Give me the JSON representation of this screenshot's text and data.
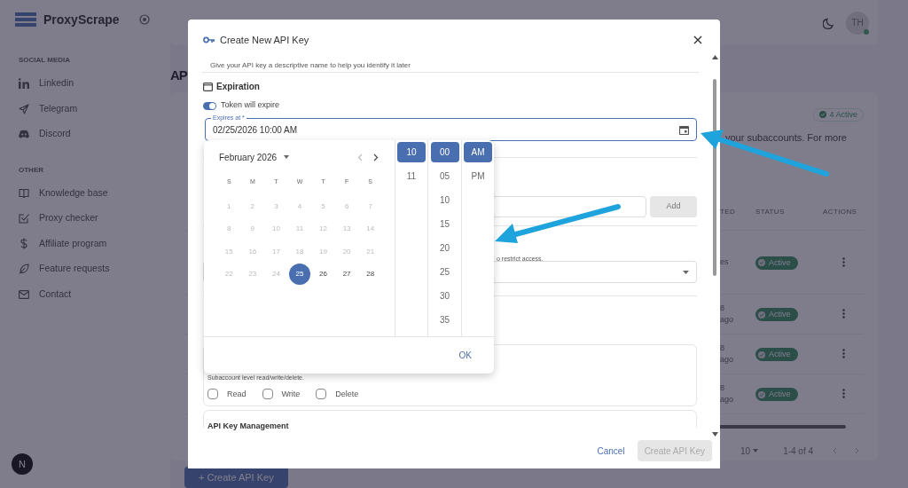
{
  "sidebar": {
    "brand": "ProxyScrape",
    "sections": [
      {
        "heading": "SOCIAL MEDIA",
        "items": [
          "Linkedin",
          "Telegram",
          "Discord"
        ]
      },
      {
        "heading": "OTHER",
        "items": [
          "Knowledge base",
          "Proxy checker",
          "Affiliate program",
          "Feature requests",
          "Contact"
        ]
      }
    ]
  },
  "header": {
    "avatar": "TH"
  },
  "page": {
    "title": "AP",
    "active_badge": "4 Active",
    "description": "your subaccounts. For more",
    "table": {
      "columns": [
        "TED",
        "STATUS",
        "ACTIONS"
      ],
      "rows": [
        {
          "created": [
            "es"
          ],
          "status": "Active"
        },
        {
          "created": [
            "8",
            "ago"
          ],
          "status": "Active"
        },
        {
          "created": [
            "8",
            "ago"
          ],
          "status": "Active"
        },
        {
          "created": [
            "8",
            "ago"
          ],
          "status": "Active"
        }
      ]
    },
    "pagination": {
      "rows_per_page": "10",
      "range": "1-4 of 4"
    },
    "create_button": "+ Create API Key"
  },
  "dev_badge": "N",
  "dialog": {
    "title": "Create New API Key",
    "subtitle": "Give your API key a descriptive name to help you identify it later",
    "expiration": {
      "heading": "Expiration",
      "toggle": {
        "label": "Token will expire",
        "on": true
      },
      "field": {
        "label": "Expires at *",
        "value": "02/25/2026 10:00 AM"
      }
    },
    "add_button": {
      "label": "Add",
      "disabled": true
    },
    "restrict_hint": "o restrict access.",
    "permissions": {
      "description": "Subaccount level read/write/delete.",
      "options": [
        {
          "label": "Read",
          "checked": false
        },
        {
          "label": "Write",
          "checked": false
        },
        {
          "label": "Delete",
          "checked": false
        }
      ]
    },
    "management_heading": "API Key Management",
    "cancel": "Cancel",
    "create": {
      "label": "Create API Key",
      "disabled": true
    }
  },
  "picker": {
    "month": "February 2026",
    "weekdays": [
      "S",
      "M",
      "T",
      "W",
      "T",
      "F",
      "S"
    ],
    "days": [
      {
        "label": "1",
        "disabled": true,
        "selected": false
      },
      {
        "label": "2",
        "disabled": true,
        "selected": false
      },
      {
        "label": "3",
        "disabled": true,
        "selected": false
      },
      {
        "label": "4",
        "disabled": true,
        "selected": false
      },
      {
        "label": "5",
        "disabled": true,
        "selected": false
      },
      {
        "label": "6",
        "disabled": true,
        "selected": false
      },
      {
        "label": "7",
        "disabled": true,
        "selected": false
      },
      {
        "label": "8",
        "disabled": true,
        "selected": false
      },
      {
        "label": "9",
        "disabled": true,
        "selected": false
      },
      {
        "label": "10",
        "disabled": true,
        "selected": false
      },
      {
        "label": "11",
        "disabled": true,
        "selected": false
      },
      {
        "label": "12",
        "disabled": true,
        "selected": false
      },
      {
        "label": "13",
        "disabled": true,
        "selected": false
      },
      {
        "label": "14",
        "disabled": true,
        "selected": false
      },
      {
        "label": "15",
        "disabled": true,
        "selected": false
      },
      {
        "label": "16",
        "disabled": true,
        "selected": false
      },
      {
        "label": "17",
        "disabled": true,
        "selected": false
      },
      {
        "label": "18",
        "disabled": true,
        "selected": false
      },
      {
        "label": "19",
        "disabled": true,
        "selected": false
      },
      {
        "label": "20",
        "disabled": true,
        "selected": false
      },
      {
        "label": "21",
        "disabled": true,
        "selected": false
      },
      {
        "label": "22",
        "disabled": true,
        "selected": false
      },
      {
        "label": "23",
        "disabled": true,
        "selected": false
      },
      {
        "label": "24",
        "disabled": true,
        "selected": false
      },
      {
        "label": "25",
        "disabled": false,
        "selected": true
      },
      {
        "label": "26",
        "disabled": false,
        "selected": false
      },
      {
        "label": "27",
        "disabled": false,
        "selected": false
      },
      {
        "label": "28",
        "disabled": false,
        "selected": false
      }
    ],
    "hours": [
      {
        "label": "10",
        "selected": true
      },
      {
        "label": "11",
        "selected": false
      }
    ],
    "minutes": [
      {
        "label": "00",
        "selected": true
      },
      {
        "label": "05",
        "selected": false
      },
      {
        "label": "10",
        "selected": false
      },
      {
        "label": "15",
        "selected": false
      },
      {
        "label": "20",
        "selected": false
      },
      {
        "label": "25",
        "selected": false
      },
      {
        "label": "30",
        "selected": false
      },
      {
        "label": "35",
        "selected": false
      }
    ],
    "periods": [
      {
        "label": "AM",
        "selected": true
      },
      {
        "label": "PM",
        "selected": false
      }
    ],
    "ok": "OK"
  }
}
